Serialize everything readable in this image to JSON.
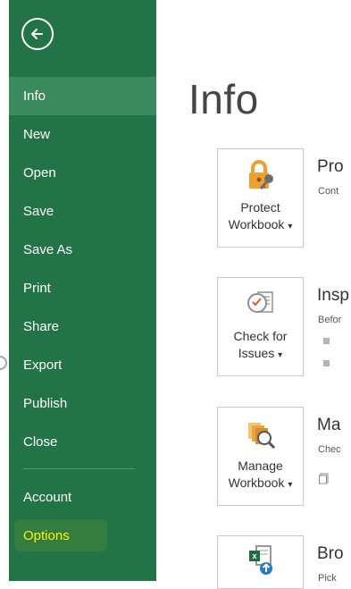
{
  "sidebar": {
    "items": [
      {
        "label": "Info"
      },
      {
        "label": "New"
      },
      {
        "label": "Open"
      },
      {
        "label": "Save"
      },
      {
        "label": "Save As"
      },
      {
        "label": "Print"
      },
      {
        "label": "Share"
      },
      {
        "label": "Export"
      },
      {
        "label": "Publish"
      },
      {
        "label": "Close"
      }
    ],
    "bottom_items": [
      {
        "label": "Account"
      },
      {
        "label": "Options"
      }
    ],
    "back_icon": "back-arrow-circle-icon",
    "active_item": "Info",
    "highlight_color": "#fff200",
    "background_color": "#227447"
  },
  "main": {
    "title": "Info",
    "sections": [
      {
        "button_line1": "Protect",
        "button_line2": "Workbook",
        "caret": "▾",
        "title": "Pro",
        "subtitle": "Cont",
        "icon": "lock-key-icon"
      },
      {
        "button_line1": "Check for",
        "button_line2": "Issues",
        "caret": "▾",
        "title": "Insp",
        "subtitle": "Befor",
        "bullets": [
          "",
          ""
        ],
        "icon": "inspect-document-icon"
      },
      {
        "button_line1": "Manage",
        "button_line2": "Workbook",
        "caret": "▾",
        "title": "Ma",
        "subtitle": "Chec",
        "icon": "manage-workbook-icon"
      },
      {
        "button_line1": "",
        "button_line2": "",
        "caret": "",
        "title": "Bro",
        "subtitle": "Pick",
        "icon": "excel-upload-icon"
      }
    ]
  }
}
